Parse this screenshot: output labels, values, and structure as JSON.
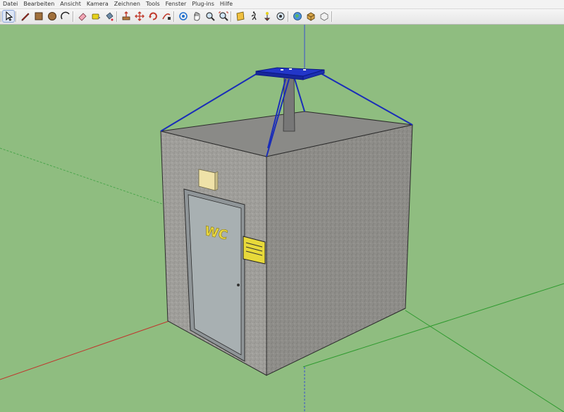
{
  "menu": [
    "Datei",
    "Bearbeiten",
    "Ansicht",
    "Kamera",
    "Zeichnen",
    "Tools",
    "Fenster",
    "Plug-ins",
    "Hilfe"
  ],
  "toolbar": {
    "active_tool": "select-icon",
    "tools": [
      "select-icon",
      "pencil-icon",
      "rectangle-icon",
      "circle-icon",
      "arc-icon",
      "eraser-icon",
      "tape-measure-icon",
      "paint-bucket-icon",
      "push-pull-icon",
      "move-icon",
      "rotate-icon",
      "follow-me-icon",
      "orbit-icon",
      "pan-icon",
      "zoom-icon",
      "zoom-extents-icon",
      "section-plane-icon",
      "walk-icon",
      "position-camera-icon",
      "look-around-icon",
      "geo-location-icon",
      "components-icon",
      "3d-warehouse-icon"
    ]
  },
  "scene": {
    "background": "#8fbd80",
    "wall_color": "#9b9b98",
    "door_color": "#a8b0b2",
    "antenna_color": "#1a2db8",
    "door_sign_text": "WC",
    "warning_sign_text": "Achtung Hochspannung Lebensgefahr"
  }
}
